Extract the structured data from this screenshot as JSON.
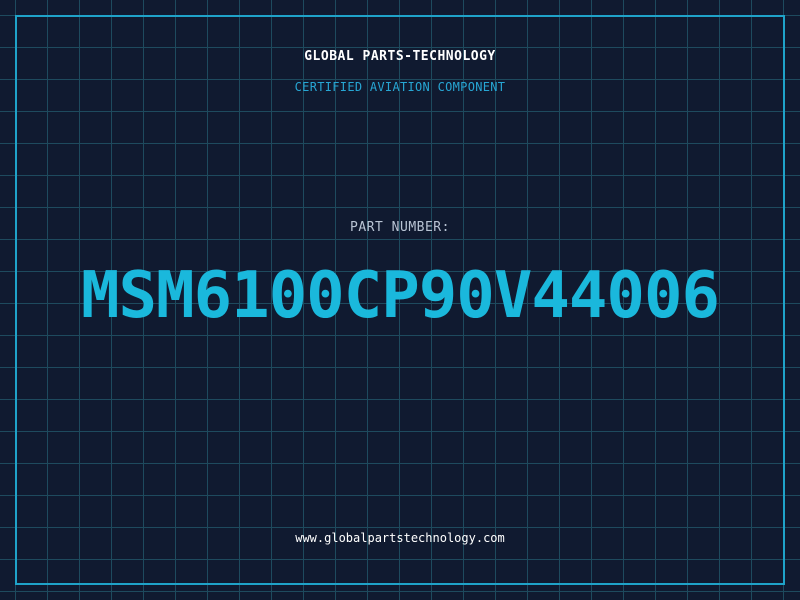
{
  "header": {
    "brand": "GLOBAL PARTS-TECHNOLOGY",
    "tagline": "CERTIFIED AVIATION COMPONENT"
  },
  "part": {
    "label": "PART NUMBER:",
    "number": "MSM6100CP90V44006"
  },
  "footer": {
    "url": "www.globalpartstechnology.com"
  },
  "colors": {
    "background": "#101a30",
    "grid": "#1e4a5e",
    "accent": "#1ab8dc",
    "frame": "#1fa3c9"
  }
}
